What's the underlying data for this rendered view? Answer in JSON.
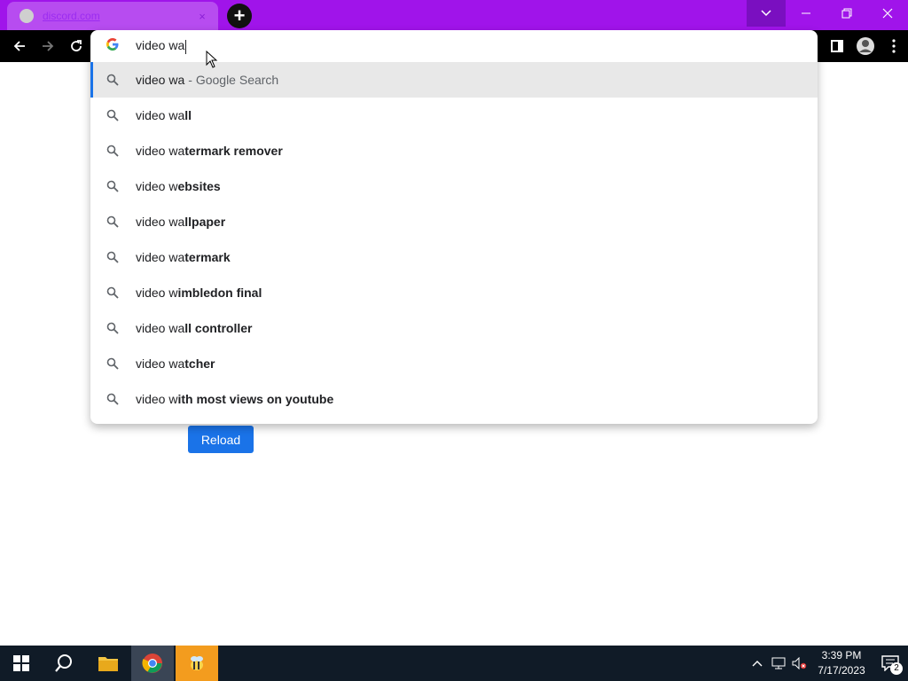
{
  "browser": {
    "tab": {
      "title": "discord.com",
      "close_icon": "×"
    },
    "new_tab_label": "+"
  },
  "omnibox": {
    "typed_text": "video wa",
    "google_icon": "G",
    "suggestions": [
      {
        "prefix": "video wa",
        "bold": "",
        "subtext": "- Google Search",
        "selected": true
      },
      {
        "prefix": "video wa",
        "bold": "ll"
      },
      {
        "prefix": "video wa",
        "bold": "termark remover"
      },
      {
        "prefix": "video w",
        "bold": "ebsites"
      },
      {
        "prefix": "video wa",
        "bold": "llpaper"
      },
      {
        "prefix": "video wa",
        "bold": "termark"
      },
      {
        "prefix": "video w",
        "bold": "imbledon final"
      },
      {
        "prefix": "video wa",
        "bold": "ll controller"
      },
      {
        "prefix": "video wa",
        "bold": "tcher"
      },
      {
        "prefix": "video w",
        "bold": "ith most views on youtube"
      }
    ]
  },
  "page": {
    "reload_label": "Reload"
  },
  "taskbar": {
    "time": "3:39 PM",
    "date": "7/17/2023",
    "notification_count": "2"
  },
  "colors": {
    "tabstrip": "#a014ea",
    "accent": "#1a73e8",
    "taskbar": "#101b27"
  }
}
